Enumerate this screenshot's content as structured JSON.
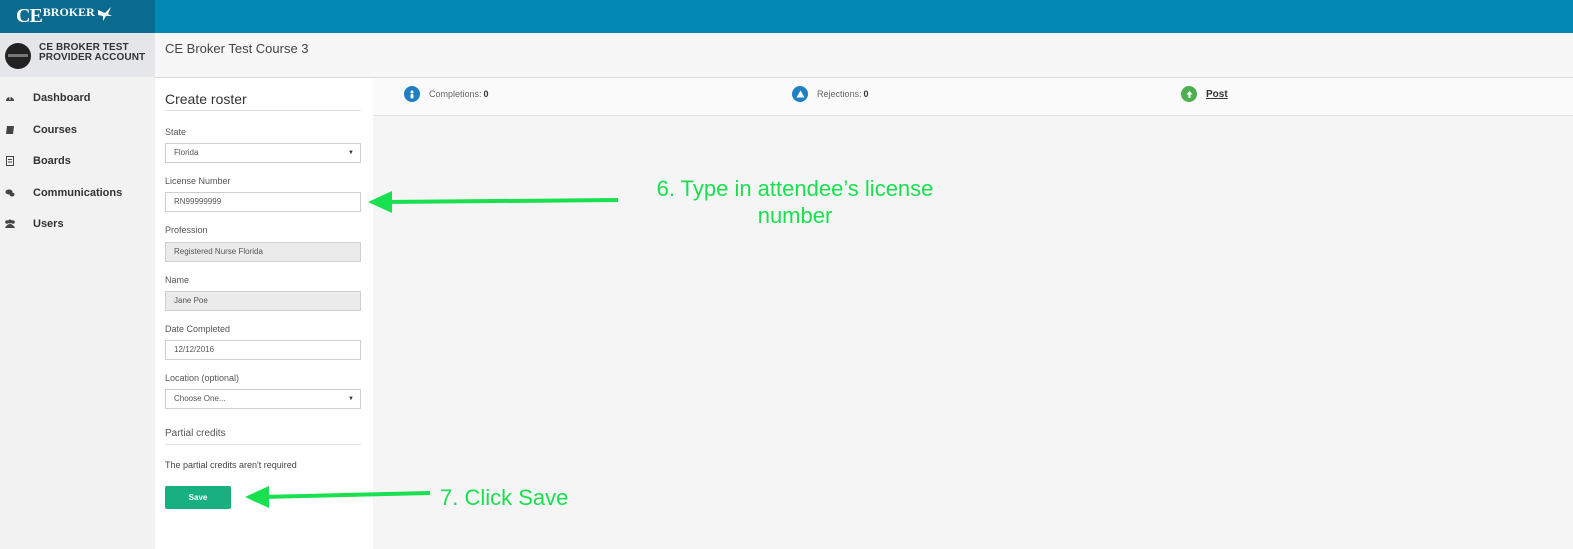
{
  "header": {
    "logo_ce": "CE",
    "logo_broker": "BROKER"
  },
  "account": {
    "name_line1": "CE BROKER TEST",
    "name_line2": "PROVIDER ACCOUNT"
  },
  "sidebar": {
    "items": [
      {
        "label": "Dashboard",
        "icon": "dashboard-icon"
      },
      {
        "label": "Courses",
        "icon": "book-icon"
      },
      {
        "label": "Boards",
        "icon": "document-icon"
      },
      {
        "label": "Communications",
        "icon": "chat-icon"
      },
      {
        "label": "Users",
        "icon": "users-icon"
      }
    ]
  },
  "course": {
    "title": "CE Broker Test Course 3"
  },
  "form": {
    "title": "Create roster",
    "state_label": "State",
    "state_value": "Florida",
    "license_label": "License Number",
    "license_value": "RN99999999",
    "profession_label": "Profession",
    "profession_value": "Registered Nurse Florida",
    "name_label": "Name",
    "name_value": "Jane Poe",
    "date_label": "Date Completed",
    "date_value": "12/12/2016",
    "location_label": "Location (optional)",
    "location_value": "Choose One...",
    "partial_title": "Partial credits",
    "partial_note": "The partial credits aren't required",
    "save_label": "Save"
  },
  "stats": {
    "completions_label": "Completions:",
    "completions_value": "0",
    "rejections_label": "Rejections:",
    "rejections_value": "0",
    "post_label": "Post"
  },
  "annotations": {
    "step6_line1": "6. Type in attendee’s license",
    "step6_line2": "number",
    "step7": "7. Click Save",
    "color": "#19e04f"
  },
  "colors": {
    "topbar": "#0288b5",
    "save_button": "#18b07e",
    "completions_icon": "#1e7fc2",
    "rejections_icon": "#1e7fc2",
    "post_icon": "#4caf50"
  }
}
